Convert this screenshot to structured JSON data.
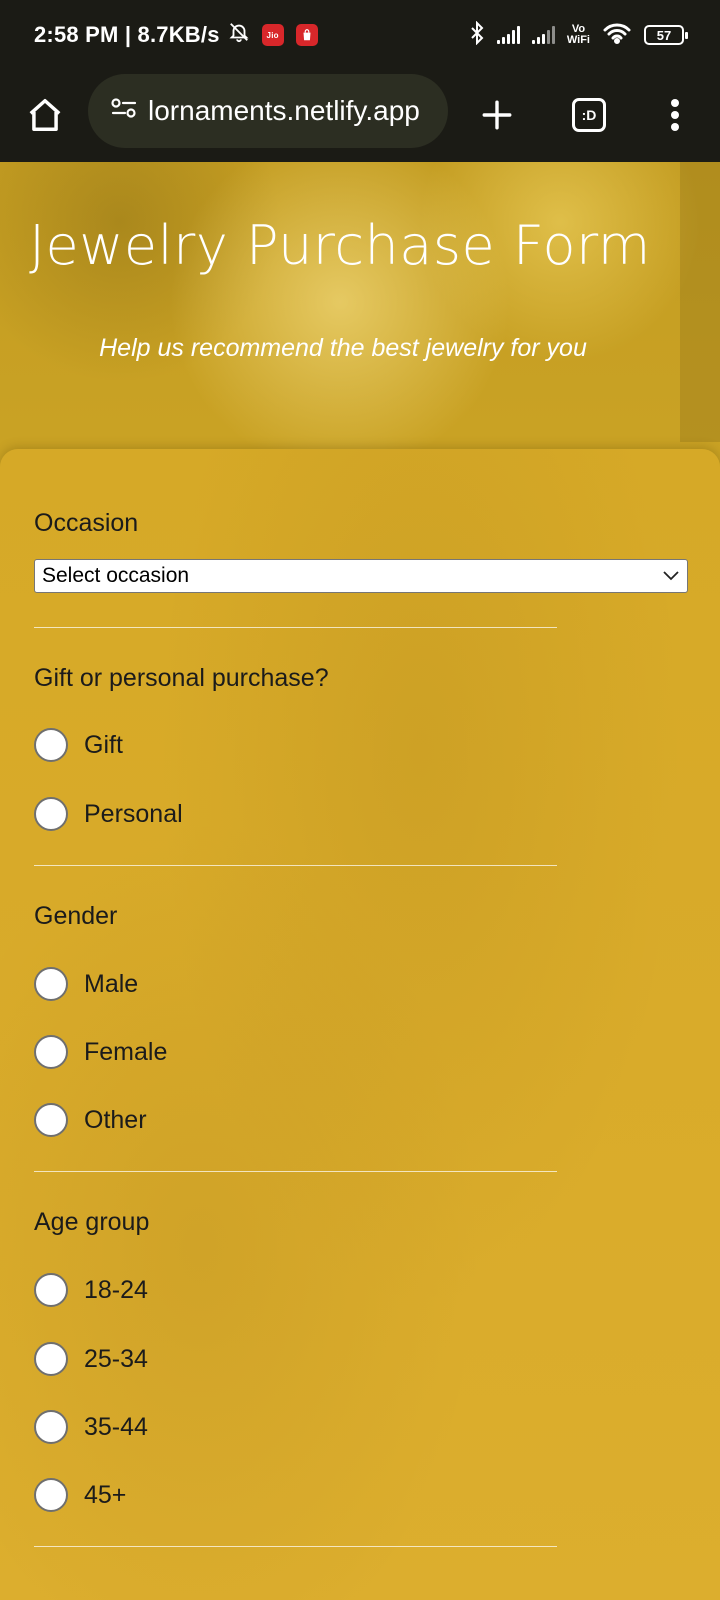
{
  "status_bar": {
    "time_speed": "2:58 PM | 8.7KB/s",
    "jio_label": "Jio",
    "vo_label": "Vo",
    "wifi_label": "WiFi",
    "battery": "57"
  },
  "browser": {
    "url": "lornaments.netlify.app",
    "tabs_label": ":D"
  },
  "hero": {
    "title": "Jewelry Purchase Form",
    "subtitle": "Help us recommend the best jewelry for you"
  },
  "form": {
    "occasion": {
      "label": "Occasion",
      "selected": "Select occasion"
    },
    "purchase_type": {
      "label": "Gift or personal purchase?",
      "options": [
        "Gift",
        "Personal"
      ]
    },
    "gender": {
      "label": "Gender",
      "options": [
        "Male",
        "Female",
        "Other"
      ]
    },
    "age_group": {
      "label": "Age group",
      "options": [
        "18-24",
        "25-34",
        "35-44",
        "45+"
      ]
    }
  }
}
